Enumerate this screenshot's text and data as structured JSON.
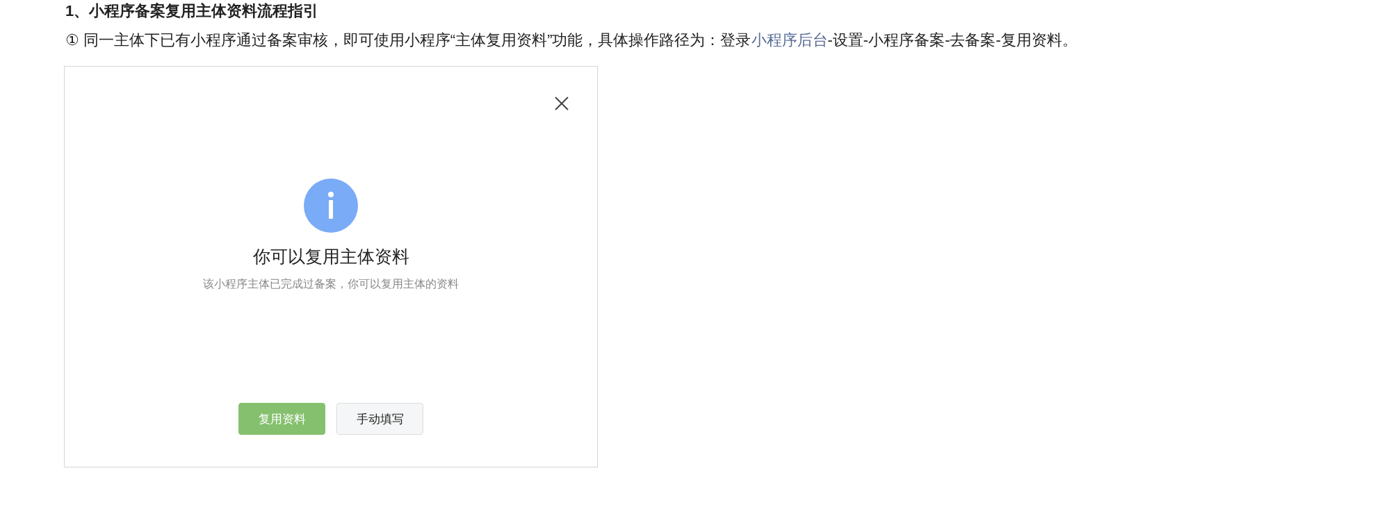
{
  "article": {
    "heading": "1、小程序备案复用主体资料流程指引",
    "paragraph": [
      {
        "kind": "text",
        "text": "① 同一主体下已有小程序通过备案审核，即可使用小程序“主体复用资料”功能，具体操作路径为：登录"
      },
      {
        "kind": "link",
        "text": "小程序后台"
      },
      {
        "kind": "text",
        "text": "-设置-小程序备案-去备案-复用资料。"
      }
    ]
  },
  "dialog": {
    "title": "你可以复用主体资料",
    "message": "该小程序主体已完成过备案，你可以复用主体的资料",
    "buttons": [
      {
        "label": "复用资料",
        "kind": "primary"
      },
      {
        "label": "手动填写",
        "kind": "default"
      }
    ]
  }
}
